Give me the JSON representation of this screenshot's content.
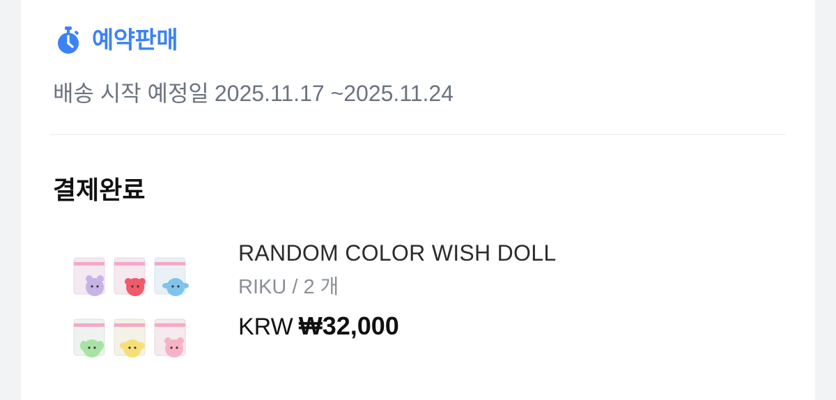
{
  "presale": {
    "icon": "stopwatch-icon",
    "title": "예약판매",
    "accent_color": "#3b82f6"
  },
  "shipping": {
    "label": "배송 시작 예정일",
    "date_range": "2025.11.17 ~2025.11.24"
  },
  "order": {
    "status": "결제완료",
    "item": {
      "name": "RANDOM COLOR WISH DOLL",
      "option": "RIKU / 2 개",
      "currency": "KRW",
      "price": "₩32,000",
      "thumbnail": "plush-doll-set-image"
    }
  }
}
